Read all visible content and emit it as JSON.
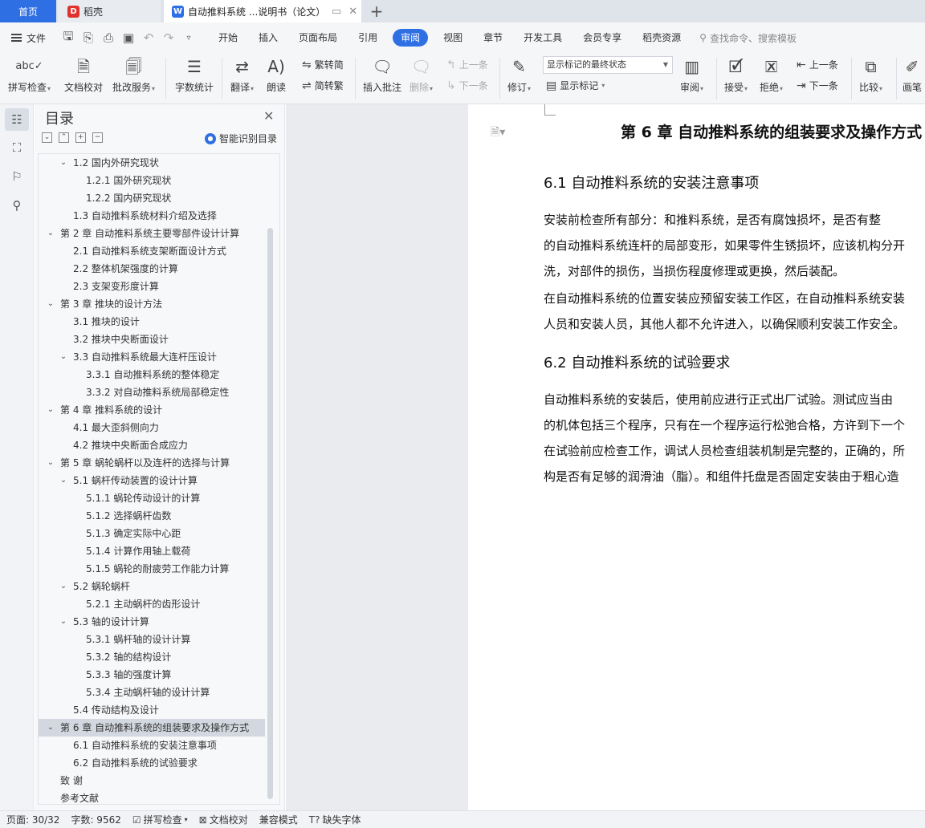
{
  "tabs": {
    "home": "首页",
    "daoke": "稻壳",
    "document": "自动推料系统 ...说明书（论文）"
  },
  "menu": {
    "file": "文件",
    "tabs": [
      "开始",
      "插入",
      "页面布局",
      "引用",
      "审阅",
      "视图",
      "章节",
      "开发工具",
      "会员专享",
      "稻壳资源"
    ],
    "active_tab": "审阅",
    "search": "查找命令、搜索模板"
  },
  "ribbon": {
    "spell_check": "拼写检查",
    "doc_proof": "文档校对",
    "batch_service": "批改服务",
    "word_count": "字数统计",
    "translate": "翻译",
    "read_aloud": "朗读",
    "trad_convert": "繁转简",
    "simp_convert": "简转繁",
    "insert_comment": "插入批注",
    "delete": "删除",
    "prev_comment": "上一条",
    "next_comment": "下一条",
    "track_changes": "修订",
    "markup_state": "显示标记的最终状态",
    "show_markup": "显示标记",
    "review": "审阅",
    "accept": "接受",
    "reject": "拒绝",
    "prev_change": "上一条",
    "next_change": "下一条",
    "compare": "比较",
    "pen": "画笔"
  },
  "toc": {
    "title": "目录",
    "ai_label": "智能识别目录",
    "items": [
      {
        "text": "1.2 国内外研究现状",
        "level": 2,
        "expand": true
      },
      {
        "text": "1.2.1 国外研究现状",
        "level": 3,
        "expand": false
      },
      {
        "text": "1.2.2 国内研究现状",
        "level": 3,
        "expand": false
      },
      {
        "text": "1.3 自动推料系统材料介绍及选择",
        "level": 2,
        "expand": false
      },
      {
        "text": "第 2 章  自动推料系统主要零部件设计计算",
        "level": 1,
        "expand": true
      },
      {
        "text": "2.1 自动推料系统支架断面设计方式",
        "level": 2,
        "expand": false
      },
      {
        "text": "2.2 整体机架强度的计算",
        "level": 2,
        "expand": false
      },
      {
        "text": "2.3 支架变形度计算",
        "level": 2,
        "expand": false
      },
      {
        "text": "第 3 章  推块的设计方法",
        "level": 1,
        "expand": true
      },
      {
        "text": "3.1 推块的设计",
        "level": 2,
        "expand": false
      },
      {
        "text": "3.2 推块中央断面设计",
        "level": 2,
        "expand": false
      },
      {
        "text": "3.3 自动推料系统最大连杆压设计",
        "level": 2,
        "expand": true
      },
      {
        "text": "3.3.1 自动推料系统的整体稳定",
        "level": 3,
        "expand": false
      },
      {
        "text": "3.3.2 对自动推料系统局部稳定性",
        "level": 3,
        "expand": false
      },
      {
        "text": "第 4 章  推料系统的设计",
        "level": 1,
        "expand": true
      },
      {
        "text": "4.1 最大歪斜侧向力",
        "level": 2,
        "expand": false
      },
      {
        "text": "4.2 推块中央断面合成应力",
        "level": 2,
        "expand": false
      },
      {
        "text": "第 5 章  蜗轮蜗杆以及连杆的选择与计算",
        "level": 1,
        "expand": true
      },
      {
        "text": "5.1 蜗杆传动装置的设计计算",
        "level": 2,
        "expand": true
      },
      {
        "text": "5.1.1 蜗轮传动设计的计算",
        "level": 3,
        "expand": false
      },
      {
        "text": "5.1.2 选择蜗杆齿数",
        "level": 3,
        "expand": false
      },
      {
        "text": "5.1.3 确定实际中心距",
        "level": 3,
        "expand": false
      },
      {
        "text": "5.1.4 计算作用轴上载荷",
        "level": 3,
        "expand": false
      },
      {
        "text": "5.1.5 蜗轮的耐疲劳工作能力计算",
        "level": 3,
        "expand": false
      },
      {
        "text": "5.2 蜗轮蜗杆",
        "level": 2,
        "expand": true
      },
      {
        "text": "5.2.1 主动蜗杆的齿形设计",
        "level": 3,
        "expand": false
      },
      {
        "text": "5.3 轴的设计计算",
        "level": 2,
        "expand": true
      },
      {
        "text": "5.3.1 蜗杆轴的设计计算",
        "level": 3,
        "expand": false
      },
      {
        "text": "5.3.2 轴的结构设计",
        "level": 3,
        "expand": false
      },
      {
        "text": "5.3.3 轴的强度计算",
        "level": 3,
        "expand": false
      },
      {
        "text": "5.3.4 主动蜗杆轴的设计计算",
        "level": 3,
        "expand": false
      },
      {
        "text": "5.4 传动结构及设计",
        "level": 2,
        "expand": false
      },
      {
        "text": "第 6 章  自动推料系统的组装要求及操作方式",
        "level": 1,
        "expand": true,
        "selected": true
      },
      {
        "text": "6.1 自动推料系统的安装注意事项",
        "level": 2,
        "expand": false
      },
      {
        "text": "6.2 自动推料系统的试验要求",
        "level": 2,
        "expand": false
      },
      {
        "text": "致    谢",
        "level": 1,
        "expand": false
      },
      {
        "text": "参考文献",
        "level": 1,
        "expand": false
      }
    ]
  },
  "document": {
    "chapter_title": "第 6 章  自动推料系统的组装要求及操作方式",
    "section1_title": "6.1 自动推料系统的安装注意事项",
    "p1": [
      "      安装前检查所有部分：和推料系统，是否有腐蚀损坏，是否有整",
      "的自动推料系统连杆的局部变形，如果零件生锈损坏，应该机构分开",
      "洗，对部件的损伤，当损伤程度修理或更换，然后装配。"
    ],
    "p2": [
      "  在自动推料系统的位置安装应预留安装工作区，在自动推料系统安装",
      "人员和安装人员，其他人都不允许进入，以确保顺利安装工作安全。"
    ],
    "section2_title": "6.2 自动推料系统的试验要求",
    "p3": [
      "    自动推料系统的安装后，使用前应进行正式出厂试验。测试应当由",
      "的机体包括三个程序，只有在一个程序运行松弛合格，方许到下一个",
      "在试验前应检查工作，调试人员检查组装机制是完整的，正确的，所",
      "构是否有足够的润滑油（脂）。和组件托盘是否固定安装由于粗心造"
    ]
  },
  "status": {
    "page": "页面: 30/32",
    "words": "字数: 9562",
    "spell_check": "拼写检查",
    "doc_proof": "文档校对",
    "compat_mode": "兼容模式",
    "missing_font": "缺失字体"
  }
}
